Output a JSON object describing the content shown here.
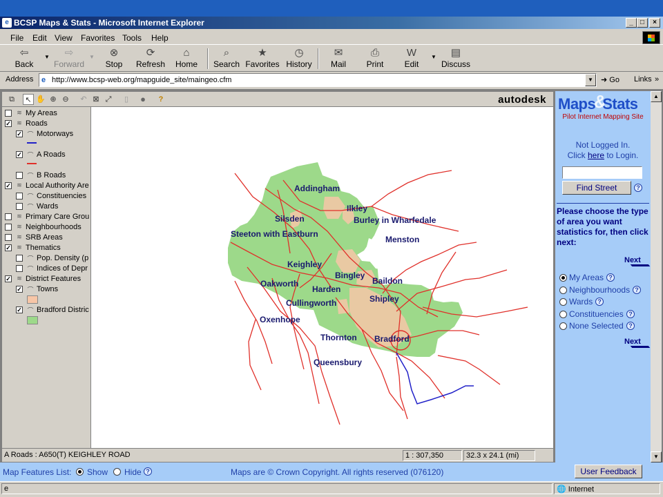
{
  "window": {
    "title": "BCSP Maps & Stats - Microsoft Internet Explorer",
    "min": "_",
    "max": "□",
    "close": "×"
  },
  "menu": [
    "File",
    "Edit",
    "View",
    "Favorites",
    "Tools",
    "Help"
  ],
  "toolbar": {
    "back": "Back",
    "forward": "Forward",
    "stop": "Stop",
    "refresh": "Refresh",
    "home": "Home",
    "search": "Search",
    "favorites": "Favorites",
    "history": "History",
    "mail": "Mail",
    "print": "Print",
    "edit": "Edit",
    "discuss": "Discuss"
  },
  "address": {
    "label": "Address",
    "url": "http://www.bcsp-web.org/mapguide_site/maingeo.cfm",
    "go": "Go",
    "links": "Links"
  },
  "map_toolbar": {
    "brand": "autodesk"
  },
  "layers": [
    {
      "label": "My Areas",
      "checked": false,
      "indent": 0
    },
    {
      "label": "Roads",
      "checked": true,
      "indent": 0
    },
    {
      "label": "Motorways",
      "checked": true,
      "indent": 1
    },
    {
      "label": "A Roads",
      "checked": true,
      "indent": 1
    },
    {
      "label": "B Roads",
      "checked": false,
      "indent": 1
    },
    {
      "label": "Local Authority Are",
      "checked": true,
      "indent": 0
    },
    {
      "label": "Constituencies",
      "checked": false,
      "indent": 1
    },
    {
      "label": "Wards",
      "checked": false,
      "indent": 1
    },
    {
      "label": "Primary Care Grou",
      "checked": false,
      "indent": 0
    },
    {
      "label": "Neighbourhoods",
      "checked": false,
      "indent": 0
    },
    {
      "label": "SRB Areas",
      "checked": false,
      "indent": 0
    },
    {
      "label": "Thematics",
      "checked": true,
      "indent": 0
    },
    {
      "label": "Pop. Density (p",
      "checked": false,
      "indent": 1
    },
    {
      "label": "Indices of Depr",
      "checked": false,
      "indent": 1
    },
    {
      "label": "District Features",
      "checked": true,
      "indent": 0
    },
    {
      "label": "Towns",
      "checked": true,
      "indent": 1
    },
    {
      "label": "Bradford Distric",
      "checked": true,
      "indent": 1
    }
  ],
  "map_places": [
    "Addingham",
    "Ilkley",
    "Silsden",
    "Burley in Wharfedale",
    "Steeton with Eastburn",
    "Menston",
    "Keighley",
    "Bingley",
    "Baildon",
    "Oakworth",
    "Harden",
    "Shipley",
    "Cullingworth",
    "Oxenhope",
    "Thornton",
    "Bradford",
    "Queensbury"
  ],
  "map_status": {
    "feature": "A Roads : A650(T) KEIGHLEY ROAD",
    "scale": "1 : 307,350",
    "size": "32.3 x 24.1 (mi)"
  },
  "sidebar": {
    "logo_a": "Maps",
    "logo_amp": "&",
    "logo_b": "Stats",
    "subtitle": "Pilot Internet Mapping Site",
    "login_line1": "Not Logged In.",
    "login_click": "Click ",
    "login_here": "here",
    "login_to": " to Login.",
    "find_street": "Find Street",
    "prompt": "Please choose the type of area you want statistics for, then click next:",
    "next": "Next",
    "help": "?",
    "options": [
      {
        "label": "My Areas",
        "selected": true
      },
      {
        "label": "Neighbourhoods",
        "selected": false
      },
      {
        "label": "Wards",
        "selected": false
      },
      {
        "label": "Constituencies",
        "selected": false
      },
      {
        "label": "None Selected",
        "selected": false
      }
    ]
  },
  "feature_bar": {
    "label": "Map Features List:",
    "show": "Show",
    "hide": "Hide",
    "copyright": "Maps are © Crown Copyright. All rights reserved (076120)",
    "feedback": "User Feedback"
  },
  "status": {
    "zone": "Internet"
  },
  "colors": {
    "towns": "#f7c6a7",
    "district": "#9dd98a",
    "roads": "#e0302a",
    "motorways": "#2020c8"
  }
}
